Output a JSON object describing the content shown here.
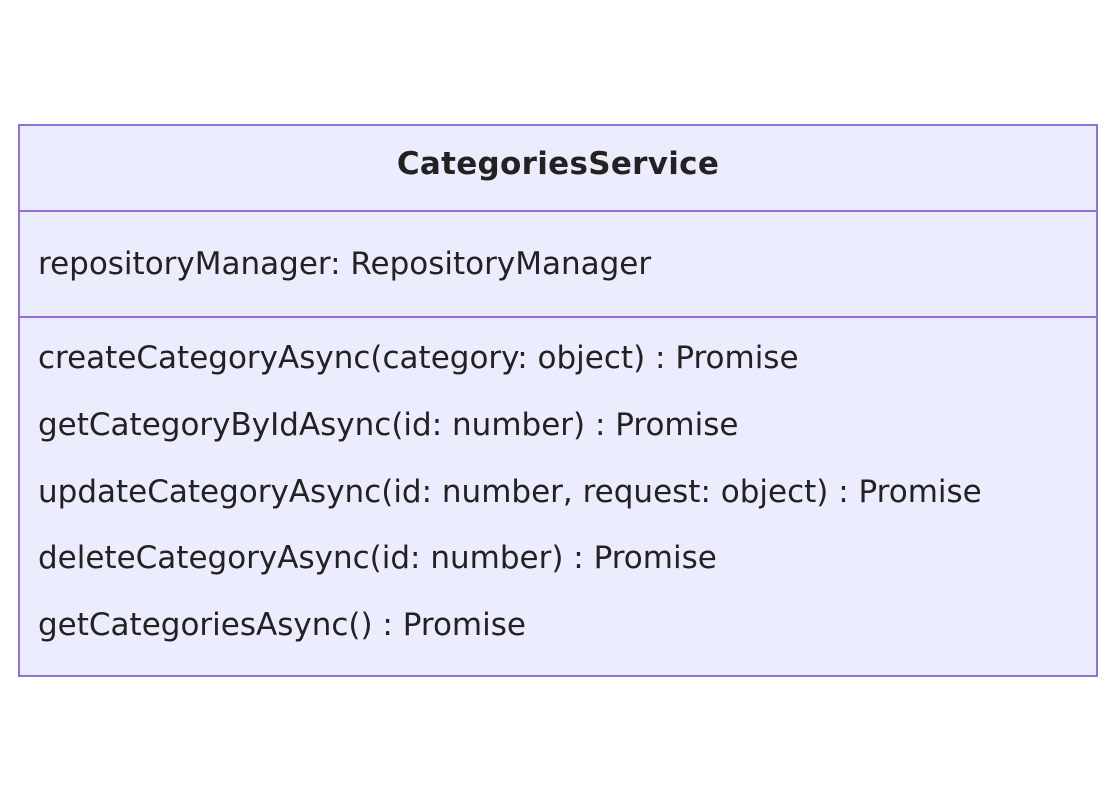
{
  "class": {
    "name": "CategoriesService",
    "attributes": [
      "repositoryManager: RepositoryManager"
    ],
    "methods": [
      "createCategoryAsync(category: object) : Promise",
      "getCategoryByIdAsync(id: number) : Promise",
      "updateCategoryAsync(id: number, request: object) : Promise",
      "deleteCategoryAsync(id: number) : Promise",
      "getCategoriesAsync() : Promise"
    ]
  },
  "colors": {
    "box_fill": "#ececff",
    "box_border": "#9370db",
    "text": "#222222",
    "background": "#ffffff"
  }
}
